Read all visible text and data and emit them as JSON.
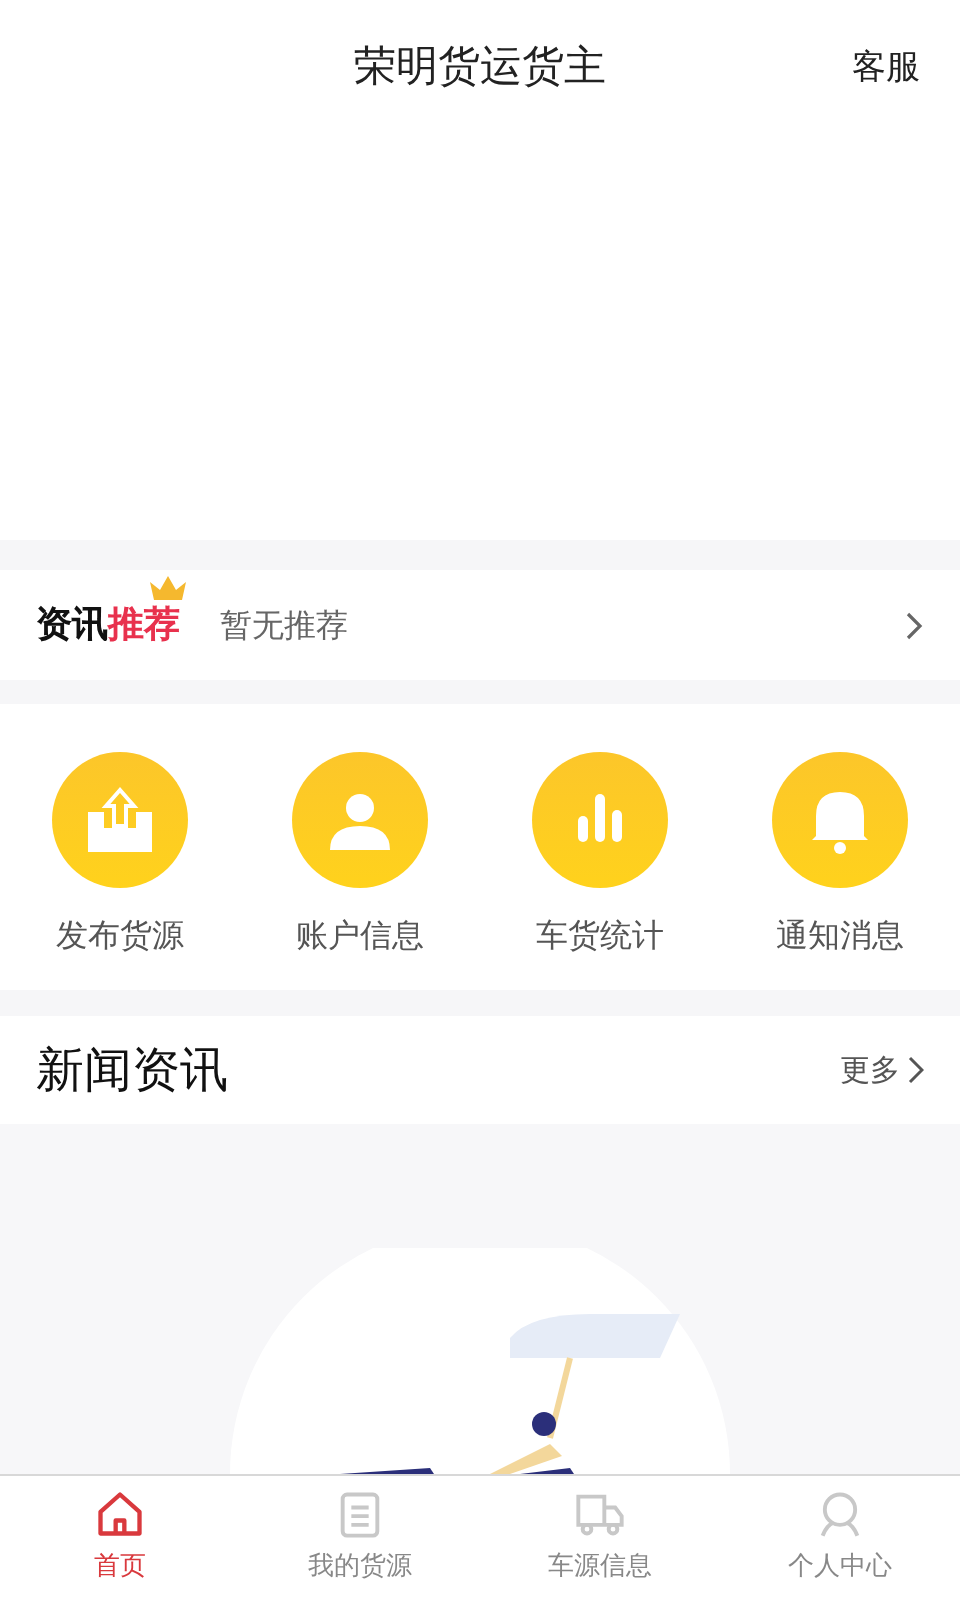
{
  "header": {
    "title": "荣明货运货主",
    "action": "客服"
  },
  "recommend": {
    "label": "资讯",
    "label_highlight": "推荐",
    "text": "暂无推荐"
  },
  "shortcuts": [
    {
      "kind": "upload",
      "label": "发布货源"
    },
    {
      "kind": "user",
      "label": "账户信息"
    },
    {
      "kind": "chart",
      "label": "车货统计"
    },
    {
      "kind": "bell",
      "label": "通知消息"
    }
  ],
  "news": {
    "title": "新闻资讯",
    "more": "更多"
  },
  "tabs": [
    {
      "kind": "home",
      "label": "首页",
      "selected": true
    },
    {
      "kind": "list",
      "label": "我的货源",
      "selected": false
    },
    {
      "kind": "truck",
      "label": "车源信息",
      "selected": false
    },
    {
      "kind": "person",
      "label": "个人中心",
      "selected": false
    }
  ]
}
